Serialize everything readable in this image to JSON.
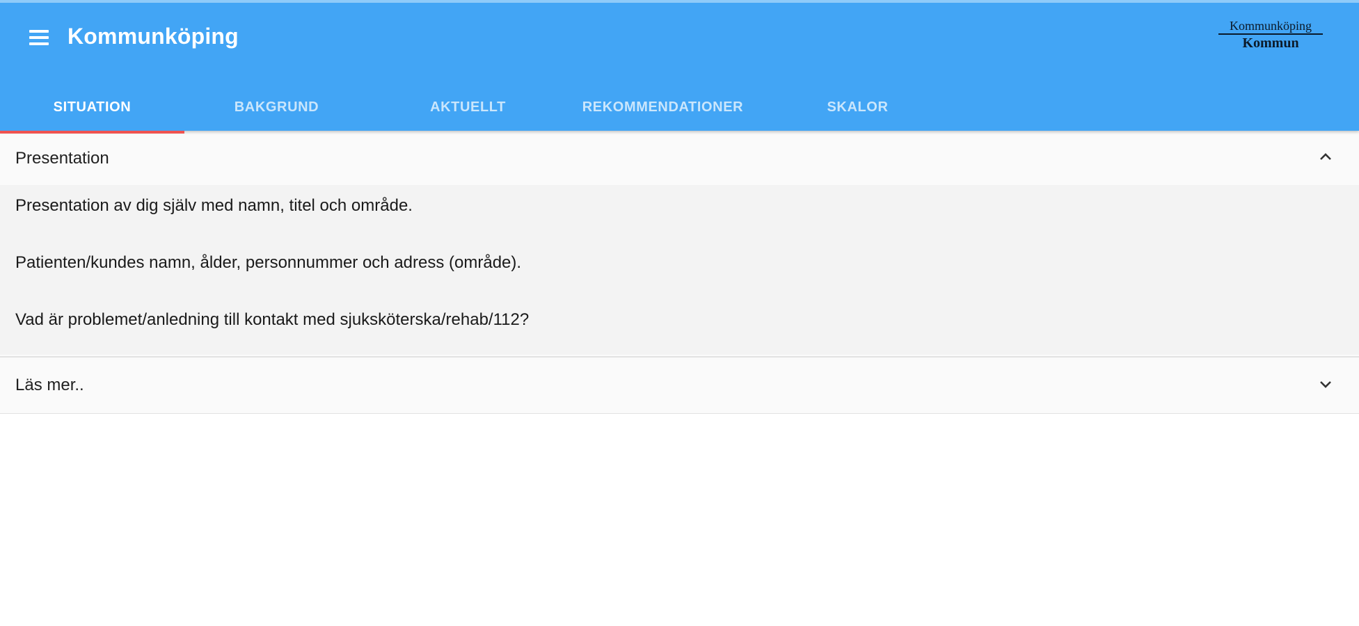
{
  "app": {
    "title": "Kommunköping",
    "logo_line1": "Kommunköping",
    "logo_line2": "Kommun"
  },
  "tabs": [
    {
      "label": "SITUATION",
      "active": true
    },
    {
      "label": "BAKGRUND",
      "active": false
    },
    {
      "label": "AKTUELLT",
      "active": false
    },
    {
      "label": "REKOMMENDATIONER",
      "active": false
    },
    {
      "label": "SKALOR",
      "active": false
    }
  ],
  "panels": [
    {
      "title": "Presentation",
      "expanded": true,
      "icon": "chevron-up-icon",
      "paragraphs": [
        "Presentation av dig själv med namn, titel och område.",
        "Patienten/kundes namn, ålder, personnummer och adress (område).",
        "Vad är problemet/anledning till kontakt med sjuksköterska/rehab/112?"
      ]
    },
    {
      "title": "Läs mer..",
      "expanded": false,
      "icon": "chevron-down-icon"
    }
  ],
  "colors": {
    "appbar": "#42a5f5",
    "tab_indicator": "#ef5350",
    "panel_bg": "#fafafa"
  }
}
